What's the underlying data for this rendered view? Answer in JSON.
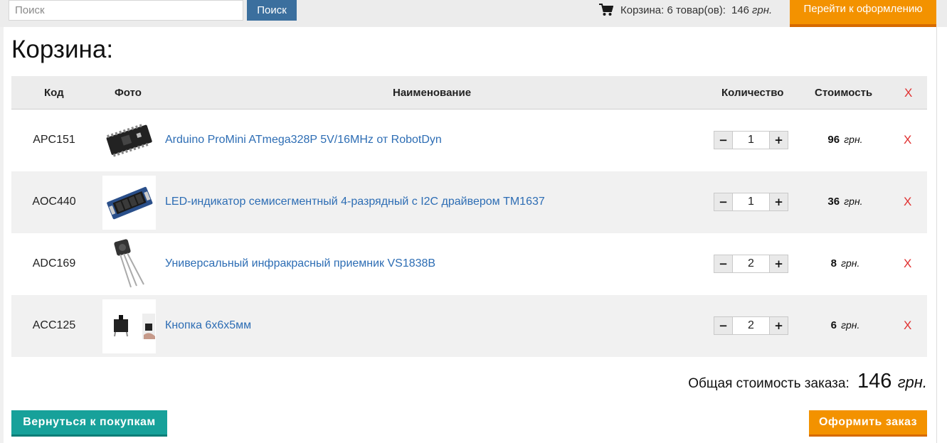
{
  "search": {
    "placeholder": "Поиск",
    "button_label": "Поиск"
  },
  "cart_summary": {
    "label": "Корзина: 6 товар(ов):",
    "sum": "146",
    "currency": "грн."
  },
  "checkout_top_label": "Перейти к оформлению",
  "page_title": "Корзина:",
  "table": {
    "headers": {
      "code": "Код",
      "photo": "Фото",
      "name": "Наименование",
      "quantity": "Количество",
      "cost": "Стоимость",
      "remove": "X"
    },
    "rows": [
      {
        "code": "APC151",
        "name": "Arduino ProMini ATmega328P 5V/16MHz от RobotDyn",
        "qty": "1",
        "price": "96",
        "currency": "грн.",
        "remove": "X",
        "photo_icon": "arduino-board-icon"
      },
      {
        "code": "AOC440",
        "name": "LED-индикатор семисегментный 4-разрядный с I2C драйвером TM1637",
        "qty": "1",
        "price": "36",
        "currency": "грн.",
        "remove": "X",
        "photo_icon": "led-display-icon"
      },
      {
        "code": "ADC169",
        "name": "Универсальный инфракрасный приемник VS1838B",
        "qty": "2",
        "price": "8",
        "currency": "грн.",
        "remove": "X",
        "photo_icon": "ir-receiver-icon"
      },
      {
        "code": "ACC125",
        "name": "Кнопка 6х6х5мм",
        "qty": "2",
        "price": "6",
        "currency": "грн.",
        "remove": "X",
        "photo_icon": "tact-button-icon"
      }
    ]
  },
  "total": {
    "label": "Общая стоимость заказа:",
    "amount": "146",
    "currency": "грн."
  },
  "back_button_label": "Вернуться к покупкам",
  "order_button_label": "Оформить заказ",
  "colors": {
    "link": "#2d6db4",
    "accent_orange": "#f39200",
    "accent_teal": "#17a19a",
    "search_button": "#3b6f9e",
    "remove": "#e03030"
  }
}
